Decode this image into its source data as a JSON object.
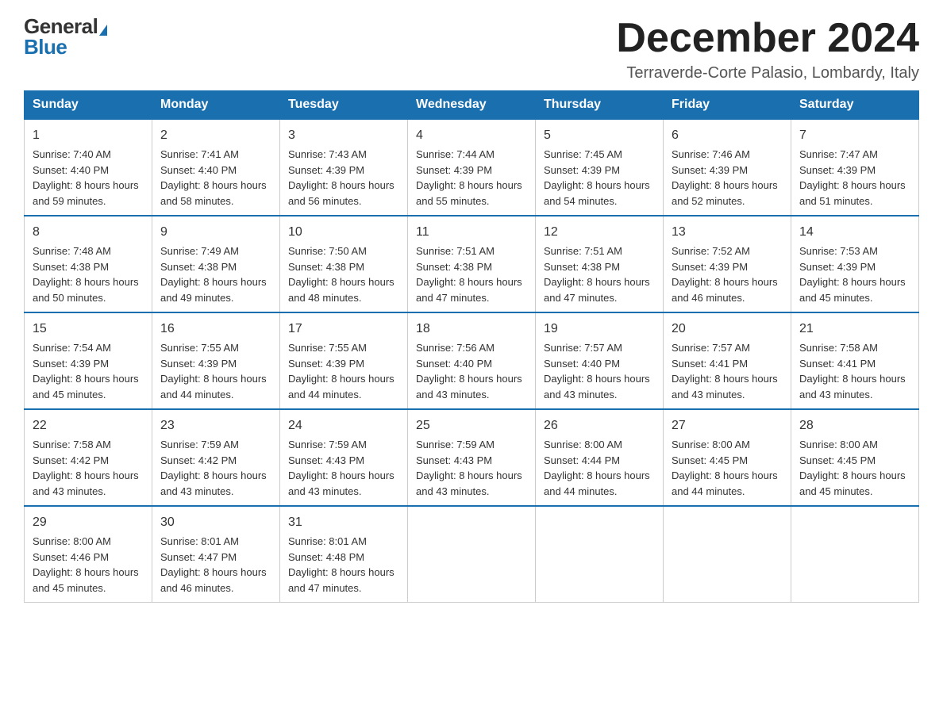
{
  "logo": {
    "general": "General",
    "blue": "Blue"
  },
  "header": {
    "month": "December 2024",
    "location": "Terraverde-Corte Palasio, Lombardy, Italy"
  },
  "weekdays": [
    "Sunday",
    "Monday",
    "Tuesday",
    "Wednesday",
    "Thursday",
    "Friday",
    "Saturday"
  ],
  "weeks": [
    [
      {
        "day": "1",
        "sunrise": "7:40 AM",
        "sunset": "4:40 PM",
        "daylight": "8 hours and 59 minutes."
      },
      {
        "day": "2",
        "sunrise": "7:41 AM",
        "sunset": "4:40 PM",
        "daylight": "8 hours and 58 minutes."
      },
      {
        "day": "3",
        "sunrise": "7:43 AM",
        "sunset": "4:39 PM",
        "daylight": "8 hours and 56 minutes."
      },
      {
        "day": "4",
        "sunrise": "7:44 AM",
        "sunset": "4:39 PM",
        "daylight": "8 hours and 55 minutes."
      },
      {
        "day": "5",
        "sunrise": "7:45 AM",
        "sunset": "4:39 PM",
        "daylight": "8 hours and 54 minutes."
      },
      {
        "day": "6",
        "sunrise": "7:46 AM",
        "sunset": "4:39 PM",
        "daylight": "8 hours and 52 minutes."
      },
      {
        "day": "7",
        "sunrise": "7:47 AM",
        "sunset": "4:39 PM",
        "daylight": "8 hours and 51 minutes."
      }
    ],
    [
      {
        "day": "8",
        "sunrise": "7:48 AM",
        "sunset": "4:38 PM",
        "daylight": "8 hours and 50 minutes."
      },
      {
        "day": "9",
        "sunrise": "7:49 AM",
        "sunset": "4:38 PM",
        "daylight": "8 hours and 49 minutes."
      },
      {
        "day": "10",
        "sunrise": "7:50 AM",
        "sunset": "4:38 PM",
        "daylight": "8 hours and 48 minutes."
      },
      {
        "day": "11",
        "sunrise": "7:51 AM",
        "sunset": "4:38 PM",
        "daylight": "8 hours and 47 minutes."
      },
      {
        "day": "12",
        "sunrise": "7:51 AM",
        "sunset": "4:38 PM",
        "daylight": "8 hours and 47 minutes."
      },
      {
        "day": "13",
        "sunrise": "7:52 AM",
        "sunset": "4:39 PM",
        "daylight": "8 hours and 46 minutes."
      },
      {
        "day": "14",
        "sunrise": "7:53 AM",
        "sunset": "4:39 PM",
        "daylight": "8 hours and 45 minutes."
      }
    ],
    [
      {
        "day": "15",
        "sunrise": "7:54 AM",
        "sunset": "4:39 PM",
        "daylight": "8 hours and 45 minutes."
      },
      {
        "day": "16",
        "sunrise": "7:55 AM",
        "sunset": "4:39 PM",
        "daylight": "8 hours and 44 minutes."
      },
      {
        "day": "17",
        "sunrise": "7:55 AM",
        "sunset": "4:39 PM",
        "daylight": "8 hours and 44 minutes."
      },
      {
        "day": "18",
        "sunrise": "7:56 AM",
        "sunset": "4:40 PM",
        "daylight": "8 hours and 43 minutes."
      },
      {
        "day": "19",
        "sunrise": "7:57 AM",
        "sunset": "4:40 PM",
        "daylight": "8 hours and 43 minutes."
      },
      {
        "day": "20",
        "sunrise": "7:57 AM",
        "sunset": "4:41 PM",
        "daylight": "8 hours and 43 minutes."
      },
      {
        "day": "21",
        "sunrise": "7:58 AM",
        "sunset": "4:41 PM",
        "daylight": "8 hours and 43 minutes."
      }
    ],
    [
      {
        "day": "22",
        "sunrise": "7:58 AM",
        "sunset": "4:42 PM",
        "daylight": "8 hours and 43 minutes."
      },
      {
        "day": "23",
        "sunrise": "7:59 AM",
        "sunset": "4:42 PM",
        "daylight": "8 hours and 43 minutes."
      },
      {
        "day": "24",
        "sunrise": "7:59 AM",
        "sunset": "4:43 PM",
        "daylight": "8 hours and 43 minutes."
      },
      {
        "day": "25",
        "sunrise": "7:59 AM",
        "sunset": "4:43 PM",
        "daylight": "8 hours and 43 minutes."
      },
      {
        "day": "26",
        "sunrise": "8:00 AM",
        "sunset": "4:44 PM",
        "daylight": "8 hours and 44 minutes."
      },
      {
        "day": "27",
        "sunrise": "8:00 AM",
        "sunset": "4:45 PM",
        "daylight": "8 hours and 44 minutes."
      },
      {
        "day": "28",
        "sunrise": "8:00 AM",
        "sunset": "4:45 PM",
        "daylight": "8 hours and 45 minutes."
      }
    ],
    [
      {
        "day": "29",
        "sunrise": "8:00 AM",
        "sunset": "4:46 PM",
        "daylight": "8 hours and 45 minutes."
      },
      {
        "day": "30",
        "sunrise": "8:01 AM",
        "sunset": "4:47 PM",
        "daylight": "8 hours and 46 minutes."
      },
      {
        "day": "31",
        "sunrise": "8:01 AM",
        "sunset": "4:48 PM",
        "daylight": "8 hours and 47 minutes."
      },
      null,
      null,
      null,
      null
    ]
  ]
}
